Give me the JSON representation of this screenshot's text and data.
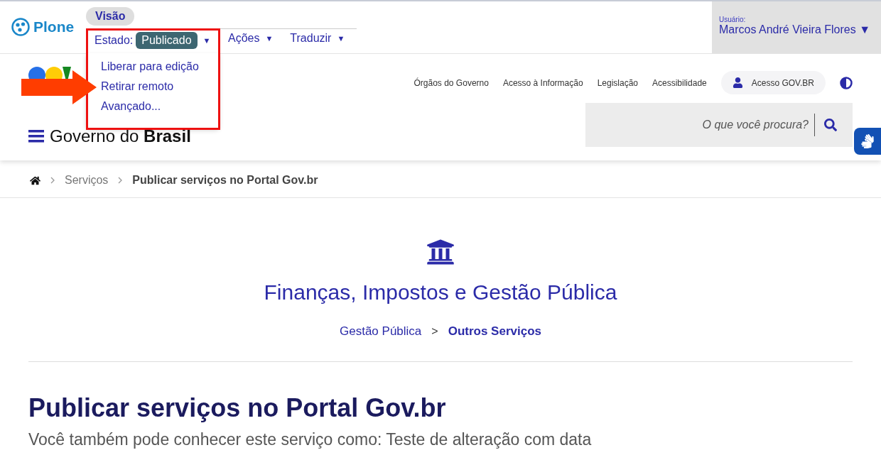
{
  "toolbar": {
    "logo": "Plone",
    "view_tab": {
      "label": "Visão",
      "selected": true
    },
    "menus": [
      {
        "label": "Estado:",
        "badge": "Publicado",
        "caret": "▼",
        "expanded": true
      },
      {
        "label": "Ações",
        "caret": "▼",
        "expanded": false
      },
      {
        "label": "Traduzir",
        "caret": "▼",
        "expanded": false
      }
    ],
    "state_menu_items": [
      "Liberar para edição",
      "Retirar remoto",
      "Avançado..."
    ],
    "user": {
      "caption": "Usuário:",
      "name": "Marcos André Vieira Flores",
      "caret": "▼"
    }
  },
  "header": {
    "title_light": "Governo do",
    "title_bold": "Brasil",
    "links": [
      "Órgãos do Governo",
      "Acesso à Informação",
      "Legislação",
      "Acessibilidade"
    ],
    "login": "Acesso GOV.BR",
    "search": {
      "placeholder": "O que você procura?"
    }
  },
  "breadcrumb": [
    {
      "label": "Serviços",
      "current": false
    },
    {
      "label": "Publicar serviços no Portal Gov.br",
      "current": true
    }
  ],
  "category": {
    "title": "Finanças, Impostos e Gestão Pública",
    "separator": ">",
    "path": [
      {
        "label": "Gestão Pública",
        "current": false
      },
      {
        "label": "Outros Serviços",
        "current": true
      }
    ]
  },
  "page": {
    "title": "Publicar serviços no Portal Gov.br",
    "subtitle": "Você também pode conhecer este serviço como: Teste de alteração com data"
  }
}
